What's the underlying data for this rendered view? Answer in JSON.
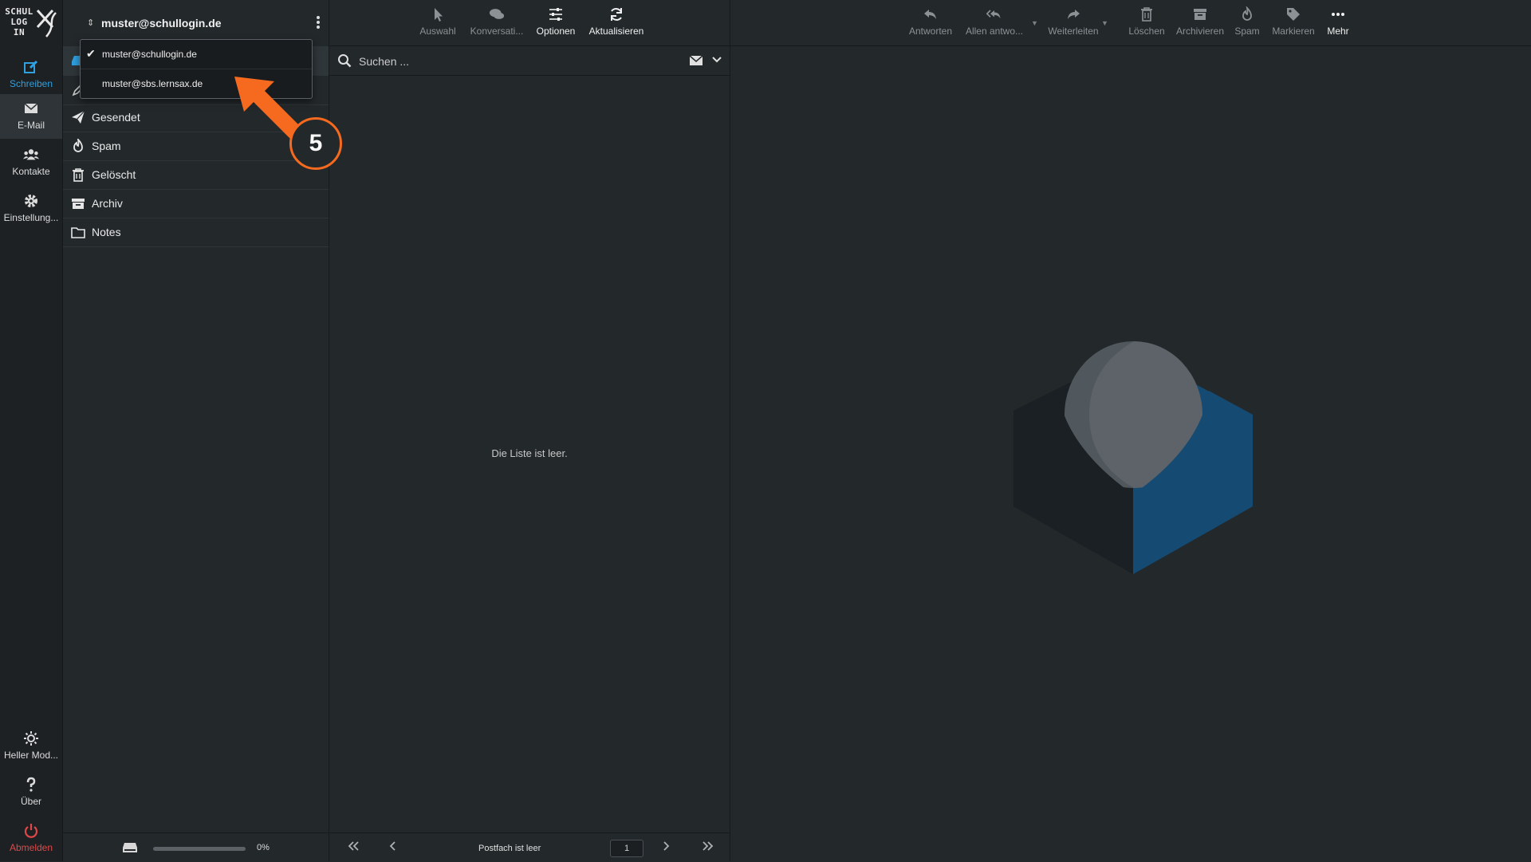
{
  "logo": {
    "text": "SCHUL LOG IN"
  },
  "rail": {
    "compose": "Schreiben",
    "mail": "E-Mail",
    "contacts": "Kontakte",
    "settings": "Einstellung...",
    "light_mode": "Heller Mod...",
    "about": "Über",
    "logout": "Abmelden"
  },
  "account": {
    "current": "muster@schullogin.de",
    "dropdown": [
      {
        "label": "muster@schullogin.de",
        "checked": true
      },
      {
        "label": "muster@sbs.lernsax.de",
        "checked": false
      }
    ]
  },
  "folders": [
    {
      "label": "Gesendet",
      "icon": "paper-plane-icon"
    },
    {
      "label": "Spam",
      "icon": "fire-icon"
    },
    {
      "label": "Gelöscht",
      "icon": "trash-icon"
    },
    {
      "label": "Archiv",
      "icon": "archive-icon"
    },
    {
      "label": "Notes",
      "icon": "folder-icon"
    }
  ],
  "storage": {
    "percent_label": "0%",
    "used_fraction": 0
  },
  "list_toolbar": {
    "select": "Auswahl",
    "conversation": "Konversati...",
    "options": "Optionen",
    "refresh": "Aktualisieren"
  },
  "search": {
    "placeholder": "Suchen ..."
  },
  "list": {
    "empty": "Die Liste ist leer.",
    "pager_status": "Postfach ist leer",
    "page": "1"
  },
  "read_toolbar": {
    "reply": "Antworten",
    "reply_all": "Allen antwo...",
    "forward": "Weiterleiten",
    "delete": "Löschen",
    "archive": "Archivieren",
    "spam": "Spam",
    "mark": "Markieren",
    "more": "Mehr"
  },
  "annotation": {
    "step": "5"
  },
  "colors": {
    "accent": "#2fa0e0",
    "logout": "#e04848",
    "annotation": "#f56a1e",
    "background": "#23282b"
  }
}
